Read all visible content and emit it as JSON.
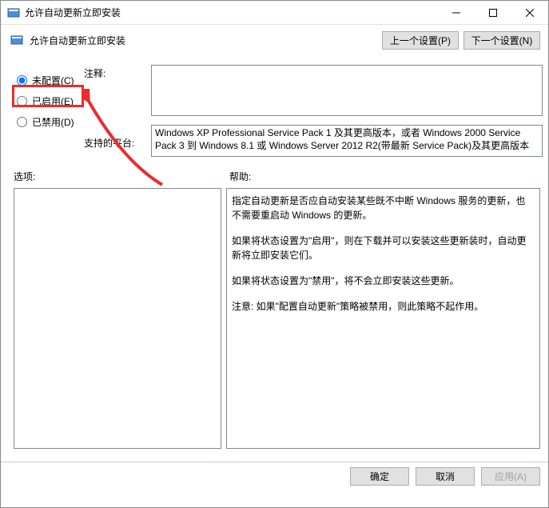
{
  "window": {
    "title": "允许自动更新立即安装"
  },
  "header": {
    "title": "允许自动更新立即安装",
    "prev": "上一个设置(P)",
    "next": "下一个设置(N)"
  },
  "radios": {
    "not_configured": "未配置(C)",
    "enabled": "已启用(E)",
    "disabled": "已禁用(D)",
    "selected": "not_configured"
  },
  "labels": {
    "comment": "注释:",
    "platform": "支持的平台:",
    "options": "选项:",
    "help": "帮助:"
  },
  "comment_value": "",
  "platform_text": "Windows XP Professional Service Pack 1 及其更高版本，或者 Windows 2000 Service Pack 3 到 Windows 8.1 或 Windows Server 2012 R2(带最新 Service Pack)及其更高版本",
  "help_text": {
    "p1": "指定自动更新是否应自动安装某些既不中断 Windows 服务的更新，也不需要重启动 Windows 的更新。",
    "p2": "如果将状态设置为\"启用\"，则在下载并可以安装这些更新装时，自动更新将立即安装它们。",
    "p3": "如果将状态设置为\"禁用\"，将不会立即安装这些更新。",
    "p4": "注意: 如果\"配置自动更新\"策略被禁用，则此策略不起作用。"
  },
  "footer": {
    "ok": "确定",
    "cancel": "取消",
    "apply": "应用(A)"
  }
}
